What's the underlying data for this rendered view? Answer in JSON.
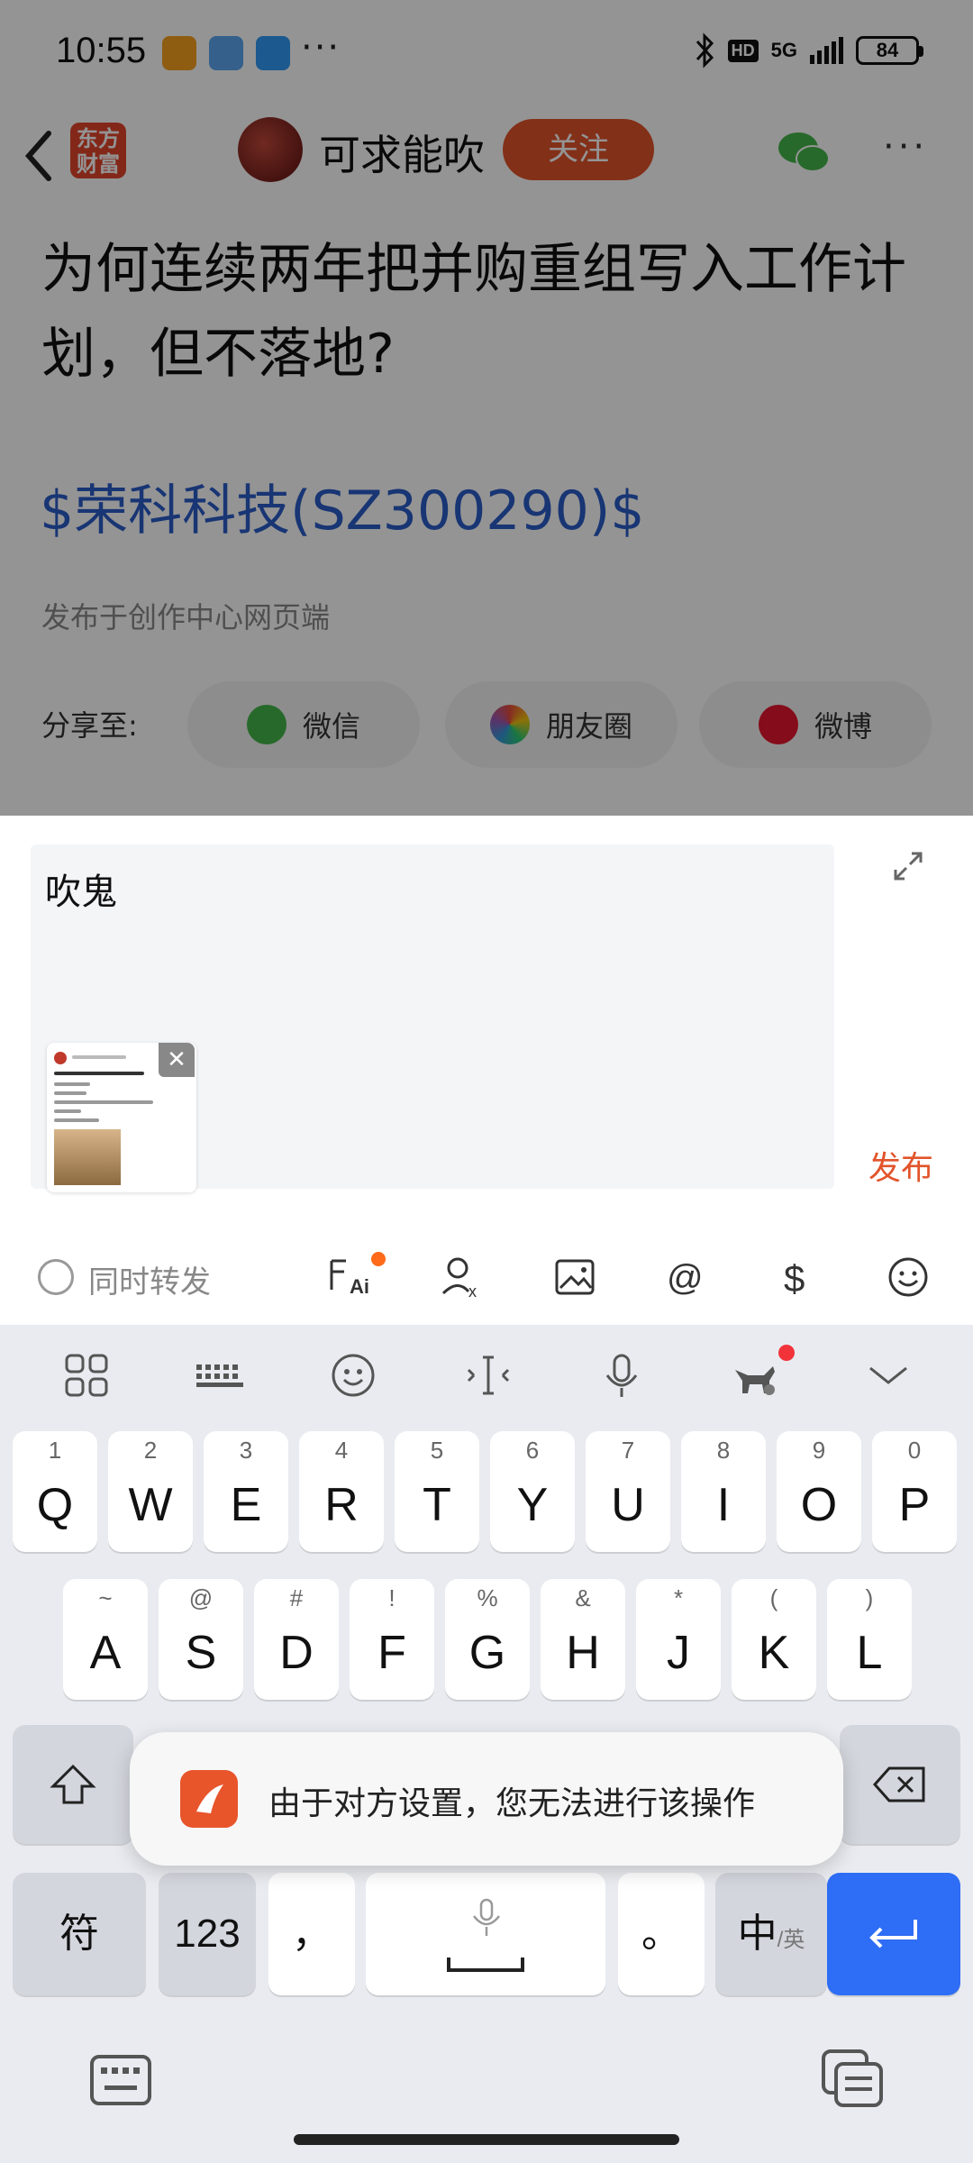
{
  "status_bar": {
    "time": "10:55",
    "more": "···",
    "hd": "HD",
    "network": "5G",
    "battery": "84"
  },
  "nav": {
    "logo_text": "东方财富",
    "username": "可求能吹",
    "follow_label": "关注"
  },
  "article": {
    "title": "为何连续两年把并购重组写入工作计划，但不落地?",
    "stock_tag": "$荣科科技(SZ300290)$",
    "publish_source": "发布于创作中心网页端",
    "share_label": "分享至:",
    "share_options": [
      {
        "label": "微信",
        "color": "#44b549"
      },
      {
        "label": "朋友圈",
        "color": "#4a90e2"
      },
      {
        "label": "微博",
        "color": "#e6162d"
      }
    ]
  },
  "comment": {
    "input_value": "吹鬼",
    "attachment_close": "✕",
    "publish_label": "发布",
    "repost_label": "同时转发"
  },
  "keyboard": {
    "row1": [
      {
        "sub": "1",
        "main": "Q"
      },
      {
        "sub": "2",
        "main": "W"
      },
      {
        "sub": "3",
        "main": "E"
      },
      {
        "sub": "4",
        "main": "R"
      },
      {
        "sub": "5",
        "main": "T"
      },
      {
        "sub": "6",
        "main": "Y"
      },
      {
        "sub": "7",
        "main": "U"
      },
      {
        "sub": "8",
        "main": "I"
      },
      {
        "sub": "9",
        "main": "O"
      },
      {
        "sub": "0",
        "main": "P"
      }
    ],
    "row2": [
      {
        "sub": "~",
        "main": "A"
      },
      {
        "sub": "@",
        "main": "S"
      },
      {
        "sub": "#",
        "main": "D"
      },
      {
        "sub": "!",
        "main": "F"
      },
      {
        "sub": "%",
        "main": "G"
      },
      {
        "sub": "&",
        "main": "H"
      },
      {
        "sub": "*",
        "main": "J"
      },
      {
        "sub": "(",
        "main": "K"
      },
      {
        "sub": ")",
        "main": "L"
      }
    ],
    "symbols_label": "符",
    "numbers_label": "123",
    "comma_label": "，",
    "period_label": "。",
    "lang_label": "中",
    "lang_sub": "/英"
  },
  "toast": {
    "message": "由于对方设置，您无法进行该操作"
  }
}
